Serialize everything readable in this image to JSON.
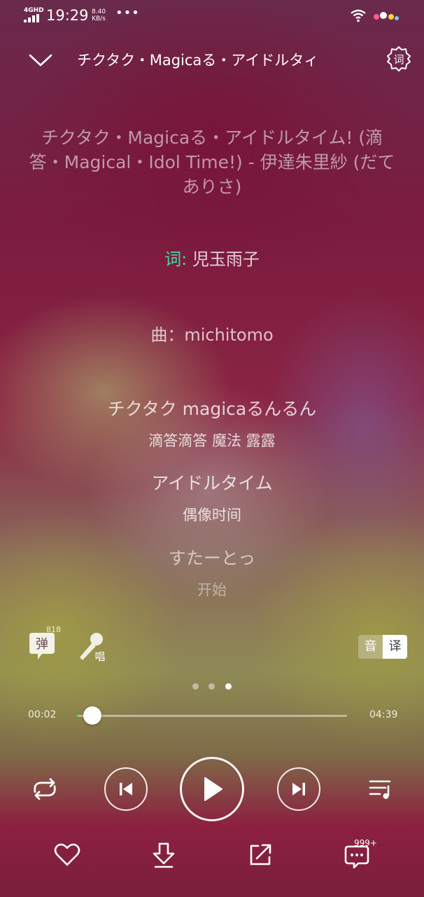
{
  "status_bar": {
    "network": "4GHD",
    "time": "19:29",
    "speed_value": "8.40",
    "speed_unit": "KB/s",
    "more": "•••"
  },
  "header": {
    "title": "チクタク・Magicaる・アイドルタィ",
    "lyric_button_label": "词"
  },
  "lyrics": {
    "song_info": "チクタク・Magicaる・アイドルタイム! (滴答・Magical・Idol Time!) - 伊達朱里紗 (だて ありさ)",
    "lyricist_label": "词",
    "lyricist_separator": ":",
    "lyricist_name": "児玉雨子",
    "composer": "曲：michitomo",
    "lines": [
      {
        "ja": "チクタク magicaるんるん",
        "zh": "滴答滴答 魔法 露露"
      },
      {
        "ja": "アイドルタイム",
        "zh": "偶像时间"
      },
      {
        "ja": "すたーとっ",
        "zh": "开始"
      }
    ]
  },
  "side_controls": {
    "danmu_label": "弹",
    "danmu_count": "818",
    "sing_label": "唱",
    "translate_options": [
      "音",
      "译"
    ],
    "translate_selected": "译"
  },
  "pager": {
    "count": 3,
    "active": 3
  },
  "progress": {
    "current": "00:02",
    "total": "04:39",
    "fraction": 0.007
  },
  "comments": {
    "count": "999+"
  }
}
